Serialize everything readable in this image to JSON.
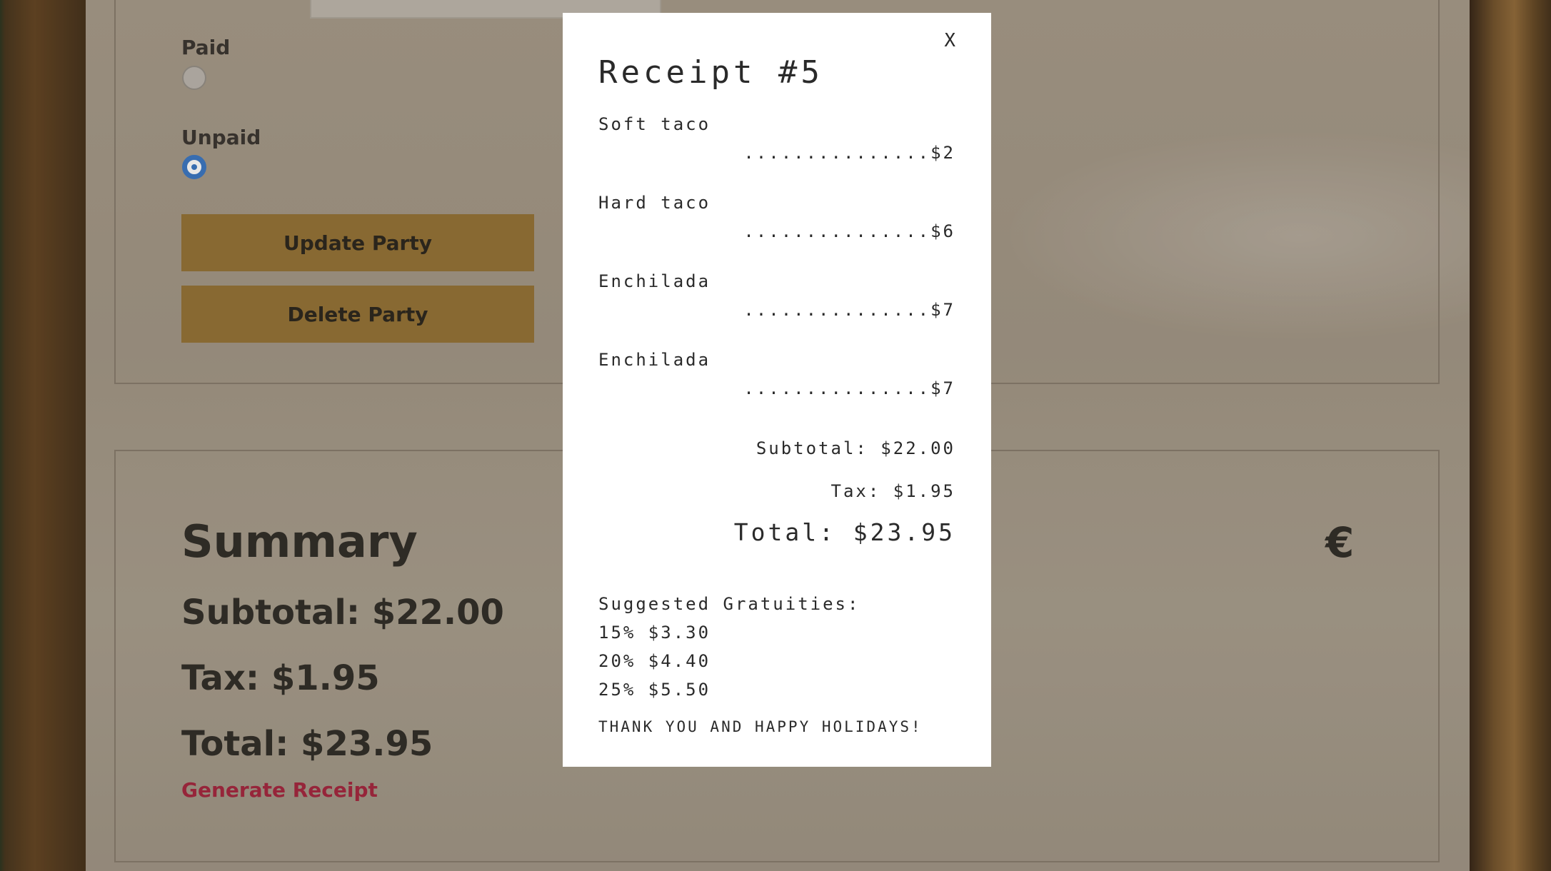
{
  "party_form": {
    "paid_label": "Paid",
    "unpaid_label": "Unpaid",
    "selected_status": "Unpaid",
    "update_button": "Update Party",
    "delete_button": "Delete Party"
  },
  "summary": {
    "title": "Summary",
    "subtotal": "Subtotal: $22.00",
    "tax": "Tax: $1.95",
    "total": "Total: $23.95",
    "generate_receipt": "Generate Receipt",
    "currency_symbol": "€"
  },
  "receipt": {
    "close_label": "X",
    "title": "Receipt #5",
    "items": [
      {
        "name": "Soft taco",
        "price": "...............$2"
      },
      {
        "name": "Hard taco",
        "price": "...............$6"
      },
      {
        "name": "Enchilada",
        "price": "...............$7"
      },
      {
        "name": "Enchilada",
        "price": "...............$7"
      }
    ],
    "subtotal": "Subtotal: $22.00",
    "tax": "Tax: $1.95",
    "total": "Total: $23.95",
    "gratuity_heading": "Suggested Gratuities:",
    "gratuities": [
      "15% $3.30",
      "20% $4.40",
      "25% $5.50"
    ],
    "thanks": "THANK YOU AND HAPPY HOLIDAYS!"
  },
  "colors": {
    "button_bg": "#8e6a2c",
    "link_color": "#9e1a35",
    "radio_selected": "#2f6fc0"
  }
}
